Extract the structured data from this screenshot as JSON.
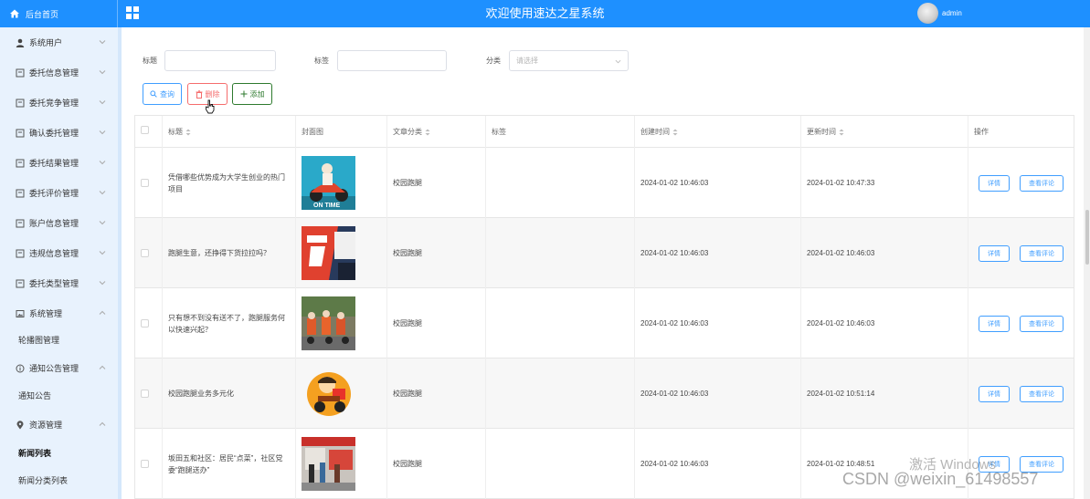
{
  "header": {
    "home_label": "后台首页",
    "app_title": "欢迎使用速达之星系统",
    "username": "admin"
  },
  "sidebar": {
    "items": [
      {
        "label": "系统用户",
        "icon": "user-icon"
      },
      {
        "label": "委托信息管理",
        "icon": "doc-icon"
      },
      {
        "label": "委托竞争管理",
        "icon": "doc-icon"
      },
      {
        "label": "确认委托管理",
        "icon": "doc-icon"
      },
      {
        "label": "委托结果管理",
        "icon": "doc-icon"
      },
      {
        "label": "委托评价管理",
        "icon": "doc-icon"
      },
      {
        "label": "账户信息管理",
        "icon": "doc-icon"
      },
      {
        "label": "违规信息管理",
        "icon": "doc-icon"
      },
      {
        "label": "委托类型管理",
        "icon": "doc-icon"
      },
      {
        "label": "系统管理",
        "icon": "image-icon"
      },
      {
        "label": "通知公告管理",
        "icon": "info-icon"
      },
      {
        "label": "资源管理",
        "icon": "pin-icon"
      }
    ],
    "subs": {
      "carousel": "轮播图管理",
      "notice": "通知公告",
      "news_list": "新闻列表",
      "news_category": "新闻分类列表"
    }
  },
  "filters": {
    "title_label": "标题",
    "tag_label": "标签",
    "category_label": "分类",
    "category_placeholder": "请选择"
  },
  "actions": {
    "search": "查询",
    "delete": "删除",
    "add": "添加"
  },
  "table": {
    "headers": {
      "title": "标题",
      "cover": "封面图",
      "category": "文章分类",
      "tags": "标签",
      "created": "创建时间",
      "updated": "更新时间",
      "ops": "操作"
    },
    "detail_label": "详情",
    "comment_label": "查看评论",
    "rows": [
      {
        "title": "凭借哪些优势成为大学生创业的热门项目",
        "category": "校园跑腿",
        "tags": "",
        "created": "2024-01-02 10:46:03",
        "updated": "2024-01-02 10:47:33"
      },
      {
        "title": "跑腿生意，还挣得下货拉拉吗？",
        "category": "校园跑腿",
        "tags": "",
        "created": "2024-01-02 10:46:03",
        "updated": "2024-01-02 10:46:03"
      },
      {
        "title": "只有想不到没有送不了，跑腿服务何以快速兴起？",
        "category": "校园跑腿",
        "tags": "",
        "created": "2024-01-02 10:46:03",
        "updated": "2024-01-02 10:46:03"
      },
      {
        "title": "校园跑腿业务多元化",
        "category": "校园跑腿",
        "tags": "",
        "created": "2024-01-02 10:46:03",
        "updated": "2024-01-02 10:51:14"
      },
      {
        "title": "坂田五和社区：居民“点菜”，社区党委“跑腿送办”",
        "category": "校园跑腿",
        "tags": "",
        "created": "2024-01-02 10:46:03",
        "updated": "2024-01-02 10:48:51"
      }
    ]
  },
  "watermarks": {
    "windows": "激活 Windows",
    "csdn": "CSDN @weixin_61498557"
  },
  "colors": {
    "header_bg": "#1e90ff",
    "sidebar_bg": "#e8f2fd",
    "primary": "#409eff",
    "danger": "#f56c6c",
    "success": "#2d7a2d"
  }
}
